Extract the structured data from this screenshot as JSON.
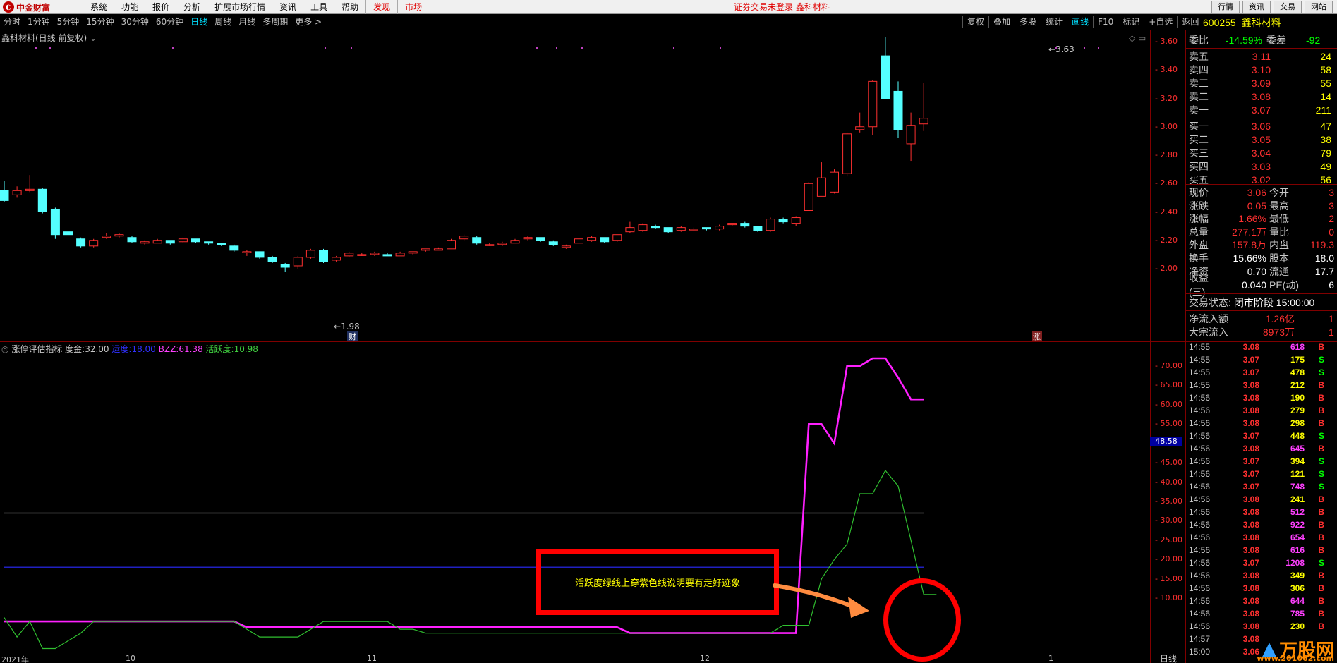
{
  "menubar": {
    "brand": "中金财富",
    "items": [
      "系统",
      "功能",
      "报价",
      "分析",
      "扩展市场行情",
      "资讯",
      "工具",
      "帮助"
    ],
    "red_items": [
      "发现",
      "市场"
    ],
    "login_status": "证券交易未登录 鑫科材料",
    "right_buttons": [
      "行情",
      "资讯",
      "交易",
      "网站"
    ]
  },
  "periods": [
    "分时",
    "1分钟",
    "5分钟",
    "15分钟",
    "30分钟",
    "60分钟",
    "日线",
    "周线",
    "月线",
    "多周期",
    "更多 >"
  ],
  "active_period": "日线",
  "toolbar2": [
    "复权",
    "叠加",
    "多股",
    "统计",
    "画线",
    "F10",
    "标记",
    "+自选",
    "返回"
  ],
  "main_chart": {
    "title": "鑫科材料(日线 前复权)",
    "high_label": "3.63",
    "low_label": "1.98",
    "cai_label": "财",
    "zhang_label": "涨",
    "y_ticks": [
      "3.60",
      "3.40",
      "3.20",
      "3.00",
      "2.80",
      "2.60",
      "2.40",
      "2.20",
      "2.00"
    ]
  },
  "sub_chart": {
    "title": "涨停评估指标",
    "params": [
      {
        "label": "度金:",
        "value": "32.00",
        "color": "#c8c8c8"
      },
      {
        "label": "运度:",
        "value": "18.00",
        "color": "#3030ff"
      },
      {
        "label": "BZZ:",
        "value": "61.38",
        "color": "#ff40ff"
      },
      {
        "label": "活跃度:",
        "value": "10.98",
        "color": "#40d040"
      }
    ],
    "y_ticks": [
      "70.00",
      "65.00",
      "60.00",
      "55.00",
      "50.00",
      "45.00",
      "40.00",
      "35.00",
      "30.00",
      "25.00",
      "20.00",
      "15.00",
      "10.00"
    ],
    "current_value_tag": "48.58",
    "x_labels": [
      "2021年",
      "10",
      "11",
      "12",
      "1"
    ],
    "period_label": "日线"
  },
  "chart_data": {
    "type": "candlestick",
    "price_axis": [
      2.0,
      3.6
    ],
    "candles": [
      [
        2.55,
        2.48,
        2.62,
        2.47
      ],
      [
        2.52,
        2.55,
        2.58,
        2.5
      ],
      [
        2.55,
        2.56,
        2.66,
        2.54
      ],
      [
        2.56,
        2.4,
        2.57,
        2.39
      ],
      [
        2.42,
        2.24,
        2.43,
        2.21
      ],
      [
        2.26,
        2.24,
        2.27,
        2.22
      ],
      [
        2.21,
        2.16,
        2.22,
        2.15
      ],
      [
        2.16,
        2.2,
        2.21,
        2.15
      ],
      [
        2.22,
        2.23,
        2.25,
        2.21
      ],
      [
        2.23,
        2.24,
        2.25,
        2.22
      ],
      [
        2.22,
        2.19,
        2.23,
        2.18
      ],
      [
        2.18,
        2.19,
        2.2,
        2.17
      ],
      [
        2.18,
        2.2,
        2.21,
        2.18
      ],
      [
        2.2,
        2.18,
        2.2,
        2.17
      ],
      [
        2.19,
        2.21,
        2.22,
        2.18
      ],
      [
        2.21,
        2.19,
        2.21,
        2.18
      ],
      [
        2.19,
        2.18,
        2.19,
        2.17
      ],
      [
        2.18,
        2.17,
        2.18,
        2.16
      ],
      [
        2.16,
        2.13,
        2.17,
        2.12
      ],
      [
        2.12,
        2.12,
        2.13,
        2.09
      ],
      [
        2.12,
        2.08,
        2.12,
        2.07
      ],
      [
        2.08,
        2.05,
        2.09,
        2.04
      ],
      [
        2.03,
        2.01,
        2.04,
        1.98
      ],
      [
        2.02,
        2.08,
        2.09,
        2.0
      ],
      [
        2.08,
        2.13,
        2.14,
        2.07
      ],
      [
        2.13,
        2.05,
        2.14,
        2.04
      ],
      [
        2.06,
        2.08,
        2.09,
        2.05
      ],
      [
        2.09,
        2.11,
        2.12,
        2.08
      ],
      [
        2.1,
        2.1,
        2.11,
        2.09
      ],
      [
        2.1,
        2.11,
        2.12,
        2.09
      ],
      [
        2.1,
        2.09,
        2.11,
        2.09
      ],
      [
        2.09,
        2.11,
        2.12,
        2.09
      ],
      [
        2.11,
        2.12,
        2.12,
        2.1
      ],
      [
        2.13,
        2.14,
        2.14,
        2.12
      ],
      [
        2.13,
        2.14,
        2.15,
        2.13
      ],
      [
        2.14,
        2.2,
        2.21,
        2.14
      ],
      [
        2.21,
        2.23,
        2.24,
        2.2
      ],
      [
        2.22,
        2.18,
        2.23,
        2.17
      ],
      [
        2.17,
        2.17,
        2.18,
        2.16
      ],
      [
        2.17,
        2.18,
        2.19,
        2.16
      ],
      [
        2.18,
        2.2,
        2.21,
        2.18
      ],
      [
        2.21,
        2.22,
        2.23,
        2.2
      ],
      [
        2.22,
        2.2,
        2.22,
        2.19
      ],
      [
        2.19,
        2.17,
        2.2,
        2.16
      ],
      [
        2.15,
        2.16,
        2.17,
        2.14
      ],
      [
        2.18,
        2.21,
        2.22,
        2.17
      ],
      [
        2.2,
        2.22,
        2.23,
        2.19
      ],
      [
        2.22,
        2.19,
        2.22,
        2.18
      ],
      [
        2.2,
        2.24,
        2.24,
        2.19
      ],
      [
        2.26,
        2.29,
        2.33,
        2.25
      ],
      [
        2.27,
        2.31,
        2.32,
        2.26
      ],
      [
        2.3,
        2.29,
        2.31,
        2.28
      ],
      [
        2.29,
        2.26,
        2.29,
        2.25
      ],
      [
        2.27,
        2.29,
        2.3,
        2.26
      ],
      [
        2.28,
        2.28,
        2.29,
        2.27
      ],
      [
        2.29,
        2.28,
        2.29,
        2.27
      ],
      [
        2.28,
        2.3,
        2.31,
        2.27
      ],
      [
        2.31,
        2.32,
        2.32,
        2.3
      ],
      [
        2.32,
        2.3,
        2.33,
        2.29
      ],
      [
        2.3,
        2.27,
        2.3,
        2.26
      ],
      [
        2.27,
        2.35,
        2.36,
        2.26
      ],
      [
        2.35,
        2.33,
        2.36,
        2.32
      ],
      [
        2.32,
        2.36,
        2.37,
        2.3
      ],
      [
        2.41,
        2.6,
        2.61,
        2.41
      ],
      [
        2.51,
        2.64,
        2.75,
        2.51
      ],
      [
        2.54,
        2.68,
        2.7,
        2.53
      ],
      [
        2.67,
        2.95,
        2.96,
        2.65
      ],
      [
        2.98,
        3.0,
        3.1,
        2.96
      ],
      [
        3.0,
        3.32,
        3.33,
        2.94
      ],
      [
        3.5,
        3.2,
        3.63,
        3.2
      ],
      [
        3.25,
        2.98,
        3.32,
        2.92
      ],
      [
        2.88,
        3.01,
        3.1,
        2.76
      ],
      [
        3.02,
        3.06,
        3.31,
        2.97
      ]
    ],
    "series": [
      {
        "name": "度金",
        "values": [
          32,
          32,
          32,
          32,
          32,
          32,
          32,
          32,
          32,
          32,
          32,
          32,
          32,
          32,
          32,
          32,
          32,
          32,
          32,
          32,
          32,
          32,
          32,
          32,
          32,
          32,
          32,
          32,
          32,
          32,
          32,
          32,
          32,
          32,
          32,
          32,
          32,
          32,
          32,
          32,
          32,
          32,
          32,
          32,
          32,
          32,
          32,
          32,
          32,
          32,
          32,
          32,
          32,
          32,
          32,
          32,
          32,
          32,
          32,
          32,
          32,
          32,
          32,
          32,
          32,
          32,
          32,
          32,
          32,
          32,
          32,
          32,
          32
        ]
      },
      {
        "name": "运度",
        "values": [
          18,
          18,
          18,
          18,
          18,
          18,
          18,
          18,
          18,
          18,
          18,
          18,
          18,
          18,
          18,
          18,
          18,
          18,
          18,
          18,
          18,
          18,
          18,
          18,
          18,
          18,
          18,
          18,
          18,
          18,
          18,
          18,
          18,
          18,
          18,
          18,
          18,
          18,
          18,
          18,
          18,
          18,
          18,
          18,
          18,
          18,
          18,
          18,
          18,
          18,
          18,
          18,
          18,
          18,
          18,
          18,
          18,
          18,
          18,
          18,
          18,
          18,
          18,
          18,
          18,
          18,
          18,
          18,
          18,
          18,
          18,
          18,
          18
        ]
      },
      {
        "name": "BZZ",
        "values": [
          4,
          4,
          4,
          4,
          4,
          4,
          4,
          4,
          4,
          4,
          4,
          4,
          4,
          4,
          4,
          4,
          4,
          4,
          4,
          2.5,
          2.5,
          2.5,
          2.5,
          2.5,
          2.5,
          2.5,
          2.5,
          2.5,
          2.5,
          2.5,
          2.5,
          2.5,
          2.5,
          2.5,
          2.5,
          2.5,
          2.5,
          2.5,
          2.5,
          2.5,
          2.5,
          2.5,
          2.5,
          2.5,
          2.5,
          2.5,
          2.5,
          2.5,
          2.5,
          1,
          1,
          1,
          1,
          1,
          1,
          1,
          1,
          1,
          1,
          1,
          1,
          1,
          1,
          55,
          55,
          50,
          70,
          70,
          72,
          72,
          67,
          61.38,
          61.38
        ]
      },
      {
        "name": "活跃度",
        "values": [
          5,
          0,
          4,
          -3,
          -3,
          -1,
          1,
          4,
          4,
          4,
          4,
          4,
          4,
          4,
          4,
          4,
          4,
          4,
          4,
          2,
          0,
          0,
          0,
          0,
          2,
          4,
          4,
          4,
          4,
          4,
          4,
          2,
          2,
          1,
          1,
          1,
          1,
          1,
          1,
          1,
          1,
          1,
          1,
          1,
          1,
          1,
          1,
          1,
          1,
          1,
          1,
          1,
          1,
          1,
          1,
          1,
          1,
          1,
          1,
          1,
          1,
          3,
          3,
          3,
          15,
          20,
          24,
          37,
          37,
          43,
          39,
          25,
          11,
          10.98
        ]
      }
    ],
    "y_range_sub": [
      -4,
      74
    ]
  },
  "quote": {
    "code": "600255",
    "name": "鑫科材料",
    "weibi_label": "委比",
    "weibi_value": "-14.59%",
    "weicha_label": "委差",
    "weicha_value": "-92",
    "asks": [
      {
        "label": "卖五",
        "price": "3.11",
        "vol": "24"
      },
      {
        "label": "卖四",
        "price": "3.10",
        "vol": "58"
      },
      {
        "label": "卖三",
        "price": "3.09",
        "vol": "55"
      },
      {
        "label": "卖二",
        "price": "3.08",
        "vol": "14"
      },
      {
        "label": "卖一",
        "price": "3.07",
        "vol": "211"
      }
    ],
    "bids": [
      {
        "label": "买一",
        "price": "3.06",
        "vol": "47"
      },
      {
        "label": "买二",
        "price": "3.05",
        "vol": "38"
      },
      {
        "label": "买三",
        "price": "3.04",
        "vol": "79"
      },
      {
        "label": "买四",
        "price": "3.03",
        "vol": "49"
      },
      {
        "label": "买五",
        "price": "3.02",
        "vol": "56"
      }
    ],
    "stats": [
      {
        "l1": "现价",
        "v1": "3.06",
        "l2": "今开",
        "v2": "3"
      },
      {
        "l1": "涨跌",
        "v1": "0.05",
        "l2": "最高",
        "v2": "3"
      },
      {
        "l1": "涨幅",
        "v1": "1.66%",
        "l2": "最低",
        "v2": "2"
      },
      {
        "l1": "总量",
        "v1": "277.1万",
        "l2": "量比",
        "v2": "0"
      },
      {
        "l1": "外盘",
        "v1": "157.8万",
        "l2": "内盘",
        "v2": "119.3"
      }
    ],
    "stats2": [
      {
        "l1": "换手",
        "v1": "15.66%",
        "l2": "股本",
        "v2": "18.0"
      },
      {
        "l1": "净资",
        "v1": "0.70",
        "l2": "流通",
        "v2": "17.7"
      },
      {
        "l1": "收益(三)",
        "v1": "0.040",
        "l2": "PE(动)",
        "v2": "6"
      }
    ],
    "trade_status_label": "交易状态:",
    "trade_status": "闭市阶段 15:00:00",
    "netflow_label": "净流入额",
    "netflow_value": "1.26亿",
    "netflow_extra": "1",
    "block_label": "大宗流入",
    "block_value": "8973万",
    "block_extra": "1"
  },
  "ticks": [
    {
      "t": "14:55",
      "p": "3.08",
      "v": "618",
      "bs": "B",
      "vc": "m"
    },
    {
      "t": "14:55",
      "p": "3.07",
      "v": "175",
      "bs": "S",
      "vc": "y"
    },
    {
      "t": "14:55",
      "p": "3.07",
      "v": "478",
      "bs": "S",
      "vc": "y"
    },
    {
      "t": "14:55",
      "p": "3.08",
      "v": "212",
      "bs": "B",
      "vc": "y"
    },
    {
      "t": "14:56",
      "p": "3.08",
      "v": "190",
      "bs": "B",
      "vc": "y"
    },
    {
      "t": "14:56",
      "p": "3.08",
      "v": "279",
      "bs": "B",
      "vc": "y"
    },
    {
      "t": "14:56",
      "p": "3.08",
      "v": "298",
      "bs": "B",
      "vc": "y"
    },
    {
      "t": "14:56",
      "p": "3.07",
      "v": "448",
      "bs": "S",
      "vc": "y"
    },
    {
      "t": "14:56",
      "p": "3.08",
      "v": "645",
      "bs": "B",
      "vc": "m"
    },
    {
      "t": "14:56",
      "p": "3.07",
      "v": "394",
      "bs": "S",
      "vc": "y"
    },
    {
      "t": "14:56",
      "p": "3.07",
      "v": "121",
      "bs": "S",
      "vc": "y"
    },
    {
      "t": "14:56",
      "p": "3.07",
      "v": "748",
      "bs": "S",
      "vc": "m"
    },
    {
      "t": "14:56",
      "p": "3.08",
      "v": "241",
      "bs": "B",
      "vc": "y"
    },
    {
      "t": "14:56",
      "p": "3.08",
      "v": "512",
      "bs": "B",
      "vc": "m"
    },
    {
      "t": "14:56",
      "p": "3.08",
      "v": "922",
      "bs": "B",
      "vc": "m"
    },
    {
      "t": "14:56",
      "p": "3.08",
      "v": "654",
      "bs": "B",
      "vc": "m"
    },
    {
      "t": "14:56",
      "p": "3.08",
      "v": "616",
      "bs": "B",
      "vc": "m"
    },
    {
      "t": "14:56",
      "p": "3.07",
      "v": "1208",
      "bs": "S",
      "vc": "m"
    },
    {
      "t": "14:56",
      "p": "3.08",
      "v": "349",
      "bs": "B",
      "vc": "y"
    },
    {
      "t": "14:56",
      "p": "3.08",
      "v": "306",
      "bs": "B",
      "vc": "y"
    },
    {
      "t": "14:56",
      "p": "3.08",
      "v": "644",
      "bs": "B",
      "vc": "m"
    },
    {
      "t": "14:56",
      "p": "3.08",
      "v": "785",
      "bs": "B",
      "vc": "m"
    },
    {
      "t": "14:56",
      "p": "3.08",
      "v": "230",
      "bs": "B",
      "vc": "y"
    },
    {
      "t": "14:57",
      "p": "3.08",
      "v": "",
      "bs": "",
      "vc": "y"
    },
    {
      "t": "15:00",
      "p": "3.06",
      "v": "",
      "bs": "",
      "vc": "y"
    }
  ],
  "annotation": {
    "text": "活跃度绿线上穿紫色线说明要有走好迹象"
  },
  "watermark": {
    "brand": "万股网",
    "url": "www.201062.com"
  },
  "colors": {
    "up": "#ff3030",
    "down": "#54ffff",
    "bzz": "#ff20ff",
    "huoyue": "#30c030",
    "dujin": "#c0c0c0",
    "yundu": "#2020c0",
    "annotation": "#ff0000",
    "arrow": "#ff8c40"
  }
}
